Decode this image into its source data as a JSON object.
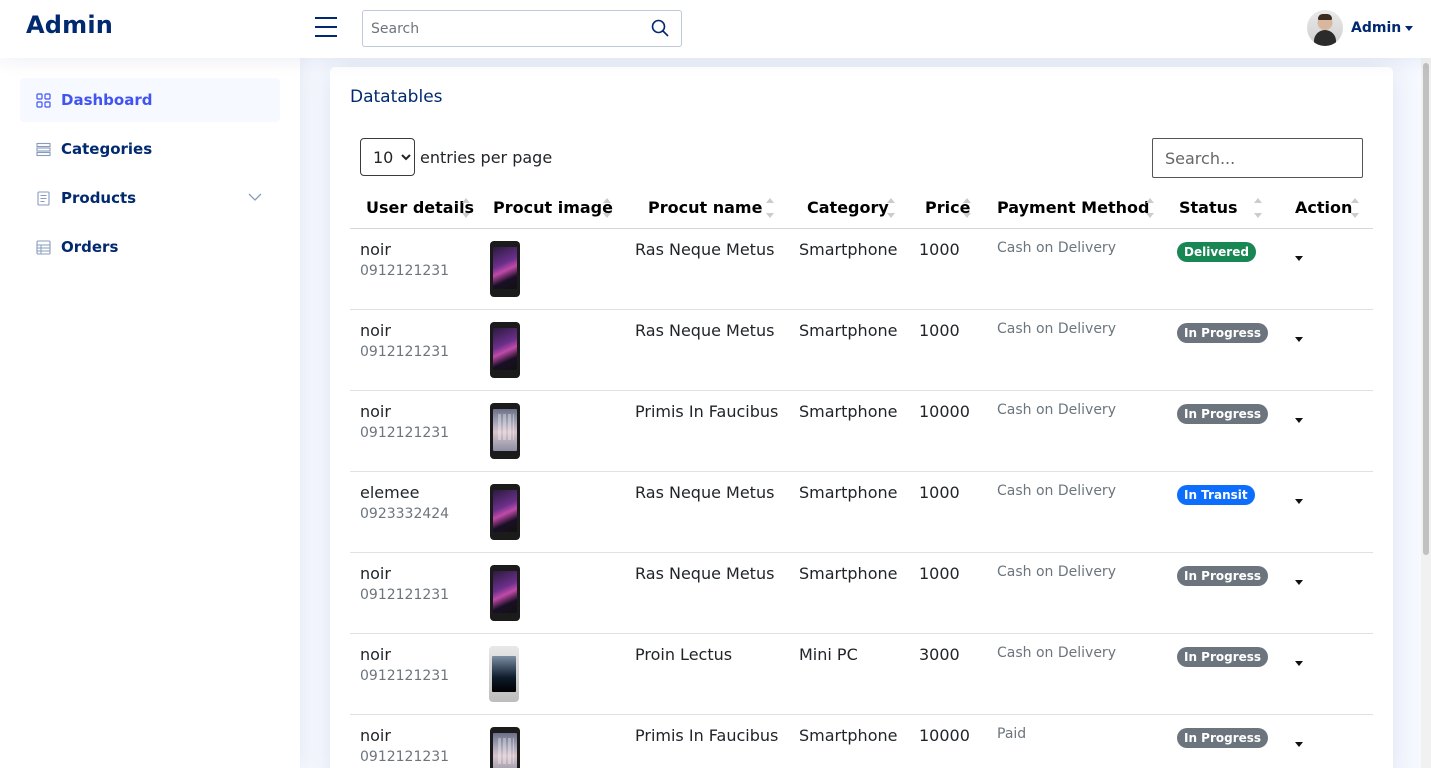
{
  "header": {
    "logo": "Admin",
    "search_placeholder": "Search",
    "profile_name": "Admin"
  },
  "sidebar": {
    "items": [
      {
        "label": "Dashboard",
        "icon": "grid-icon",
        "active": true
      },
      {
        "label": "Categories",
        "icon": "list-icon"
      },
      {
        "label": "Products",
        "icon": "document-icon"
      },
      {
        "label": "Orders",
        "icon": "table-icon"
      }
    ]
  },
  "main": {
    "title": "Datatables",
    "per_page_value": "10",
    "per_page_label": "entries per page",
    "search_placeholder": "Search...",
    "columns": [
      "User details",
      "Procut image",
      "Procut name",
      "Category",
      "Price",
      "Payment Method",
      "Status",
      "Action"
    ],
    "rows": [
      {
        "name": "noir",
        "phone": "0912121231",
        "product": "Ras Neque Metus",
        "category": "Smartphone",
        "price": "1000",
        "payment": "Cash on Delivery",
        "status": "Delivered",
        "status_color": "#198754",
        "image": "purple"
      },
      {
        "name": "noir",
        "phone": "0912121231",
        "product": "Ras Neque Metus",
        "category": "Smartphone",
        "price": "1000",
        "payment": "Cash on Delivery",
        "status": "In Progress",
        "status_color": "#6c757d",
        "image": "purple"
      },
      {
        "name": "noir",
        "phone": "0912121231",
        "product": "Primis In Faucibus",
        "category": "Smartphone",
        "price": "10000",
        "payment": "Cash on Delivery",
        "status": "In Progress",
        "status_color": "#6c757d",
        "image": "ios"
      },
      {
        "name": "elemee",
        "phone": "0923332424",
        "product": "Ras Neque Metus",
        "category": "Smartphone",
        "price": "1000",
        "payment": "Cash on Delivery",
        "status": "In Transit",
        "status_color": "#0d6efd",
        "image": "purple"
      },
      {
        "name": "noir",
        "phone": "0912121231",
        "product": "Ras Neque Metus",
        "category": "Smartphone",
        "price": "1000",
        "payment": "Cash on Delivery",
        "status": "In Progress",
        "status_color": "#6c757d",
        "image": "purple"
      },
      {
        "name": "noir",
        "phone": "0912121231",
        "product": "Proin Lectus",
        "category": "Mini PC",
        "price": "3000",
        "payment": "Cash on Delivery",
        "status": "In Progress",
        "status_color": "#6c757d",
        "image": "mini"
      },
      {
        "name": "noir",
        "phone": "0912121231",
        "product": "Primis In Faucibus",
        "category": "Smartphone",
        "price": "10000",
        "payment": "Paid",
        "status": "In Progress",
        "status_color": "#6c757d",
        "image": "ios"
      }
    ]
  }
}
